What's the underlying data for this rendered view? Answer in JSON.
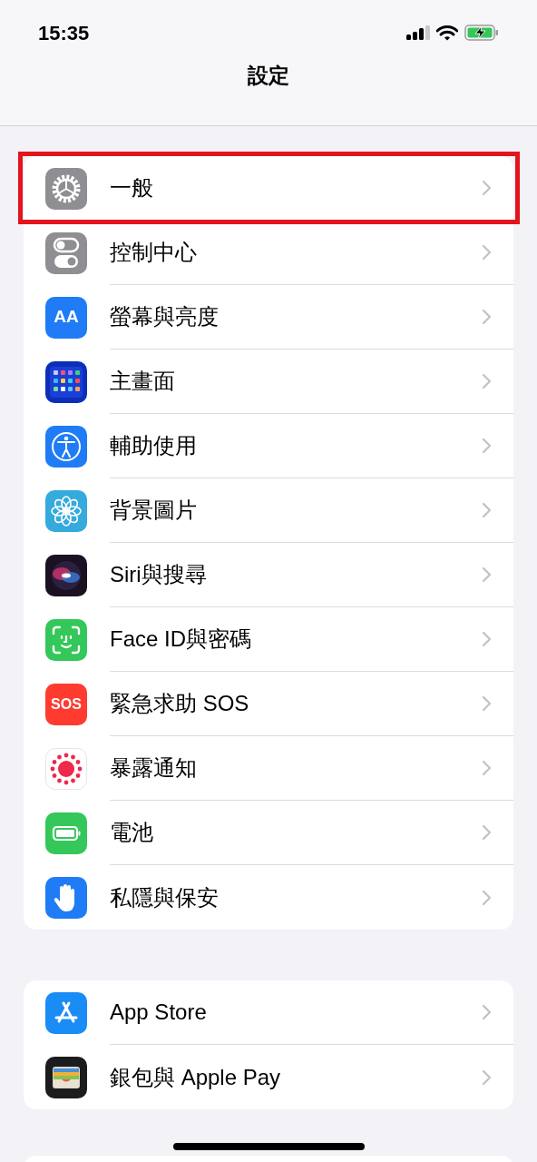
{
  "status_bar": {
    "time": "15:35"
  },
  "nav": {
    "title": "設定"
  },
  "groups": [
    {
      "items": [
        {
          "label": "一般",
          "highlighted": true
        },
        {
          "label": "控制中心",
          "highlighted": false
        },
        {
          "label": "螢幕與亮度",
          "highlighted": false,
          "icon_text": "AA"
        },
        {
          "label": "主畫面",
          "highlighted": false
        },
        {
          "label": "輔助使用",
          "highlighted": false
        },
        {
          "label": "背景圖片",
          "highlighted": false
        },
        {
          "label": "Siri與搜尋",
          "highlighted": false
        },
        {
          "label": "Face ID與密碼",
          "highlighted": false
        },
        {
          "label": "緊急求助 SOS",
          "highlighted": false,
          "icon_text": "SOS"
        },
        {
          "label": "暴露通知",
          "highlighted": false
        },
        {
          "label": "電池",
          "highlighted": false
        },
        {
          "label": "私隱與保安",
          "highlighted": false
        }
      ]
    },
    {
      "items": [
        {
          "label": "App Store",
          "highlighted": false
        },
        {
          "label": "銀包與 Apple Pay",
          "highlighted": false
        }
      ]
    }
  ]
}
